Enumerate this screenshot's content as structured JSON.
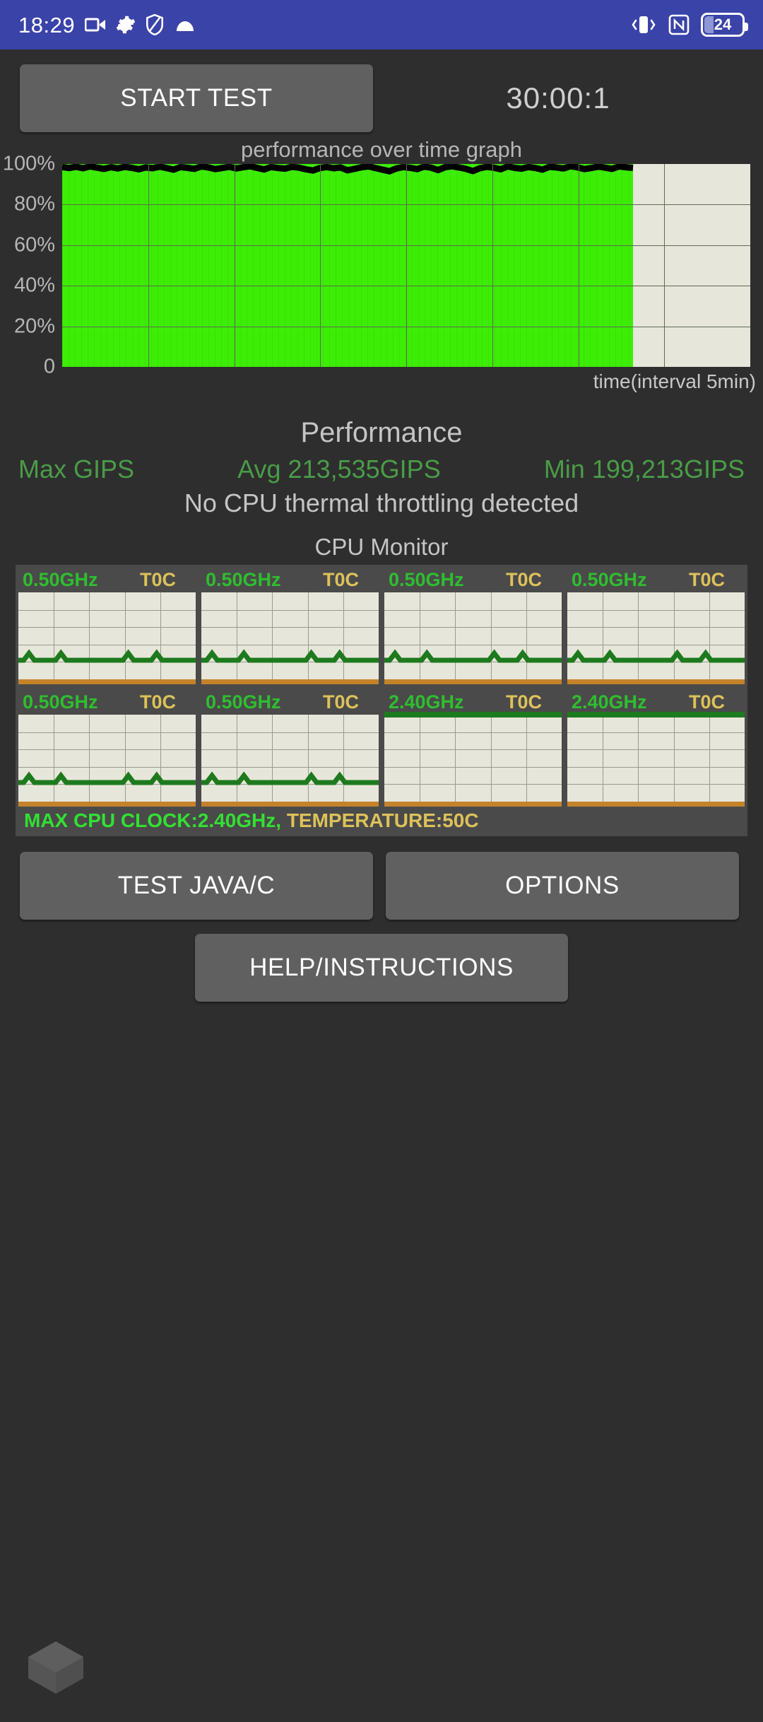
{
  "statusbar": {
    "time": "18:29",
    "left_icons": [
      "video-camera-icon",
      "gear-icon",
      "shield-icon",
      "cloud-icon"
    ],
    "right_icons": [
      "vibrate-icon",
      "nfc-icon"
    ],
    "battery_level": "24",
    "bg_color": "#3a43a8"
  },
  "toolbar": {
    "start_test_label": "START TEST",
    "timer": "30:00:1"
  },
  "chart_data": {
    "type": "area",
    "title": "performance over time graph",
    "xlabel": "time(interval 5min)",
    "ylabel": "",
    "ytick_labels": [
      "100%",
      "80%",
      "60%",
      "40%",
      "20%",
      "0"
    ],
    "ytick_values": [
      100,
      80,
      60,
      40,
      20,
      0
    ],
    "ylim": [
      0,
      100
    ],
    "xlim": [
      0,
      100
    ],
    "grid": true,
    "fill_color": "#3ded06",
    "line_color": "#000000",
    "data_extent_pct": 83,
    "values": [
      98.5,
      98.0,
      98.6,
      97.9,
      98.8,
      98.2,
      97.6,
      98.4,
      97.8,
      98.6,
      98.1,
      97.4,
      98.3,
      97.9,
      98.7,
      98.0,
      97.2,
      98.5,
      98.1,
      97.6,
      98.8,
      98.3,
      97.5,
      98.0,
      98.6,
      97.8,
      98.4,
      98.9,
      98.1,
      97.3,
      98.5,
      98.0,
      97.7,
      98.6,
      98.2,
      97.4,
      96.8,
      98.0,
      98.5,
      97.9,
      98.3,
      96.9,
      97.6,
      98.4,
      98.8,
      98.0,
      97.2,
      96.4,
      97.8,
      98.5,
      98.1,
      97.5,
      98.7,
      98.2,
      97.0,
      98.4,
      98.9,
      98.3,
      97.6,
      96.5,
      97.9,
      98.6,
      98.2,
      97.4,
      98.8,
      98.1,
      97.7,
      98.5,
      98.0,
      97.2,
      98.6,
      98.3,
      97.8,
      98.9,
      98.4,
      97.5,
      98.0,
      98.7,
      98.2,
      97.6,
      98.8,
      98.4,
      98.1
    ]
  },
  "performance": {
    "heading": "Performance",
    "max_label": "Max GIPS",
    "avg_label": "Avg 213,535GIPS",
    "min_label": "Min 199,213GIPS",
    "note": "No CPU thermal throttling detected",
    "text_color": "#4a9c48"
  },
  "cpu_monitor": {
    "heading": "CPU Monitor",
    "cores": [
      {
        "freq": "0.50GHz",
        "temp": "T0C",
        "load_pct": 22,
        "high": false
      },
      {
        "freq": "0.50GHz",
        "temp": "T0C",
        "load_pct": 22,
        "high": false
      },
      {
        "freq": "0.50GHz",
        "temp": "T0C",
        "load_pct": 22,
        "high": false
      },
      {
        "freq": "0.50GHz",
        "temp": "T0C",
        "load_pct": 22,
        "high": false
      },
      {
        "freq": "0.50GHz",
        "temp": "T0C",
        "load_pct": 22,
        "high": false
      },
      {
        "freq": "0.50GHz",
        "temp": "T0C",
        "load_pct": 22,
        "high": false
      },
      {
        "freq": "2.40GHz",
        "temp": "T0C",
        "load_pct": 100,
        "high": true
      },
      {
        "freq": "2.40GHz",
        "temp": "T0C",
        "load_pct": 100,
        "high": true
      }
    ],
    "footer_clock": "MAX CPU CLOCK:2.40GHz,",
    "footer_temp": " TEMPERATURE:50C",
    "freq_color": "#2fbe2f",
    "temp_color": "#ddc25a"
  },
  "buttons": {
    "test_java_c": "TEST JAVA/C",
    "options": "OPTIONS",
    "help_instructions": "HELP/INSTRUCTIONS"
  },
  "navbar": {
    "home_icon": "cube-icon"
  }
}
